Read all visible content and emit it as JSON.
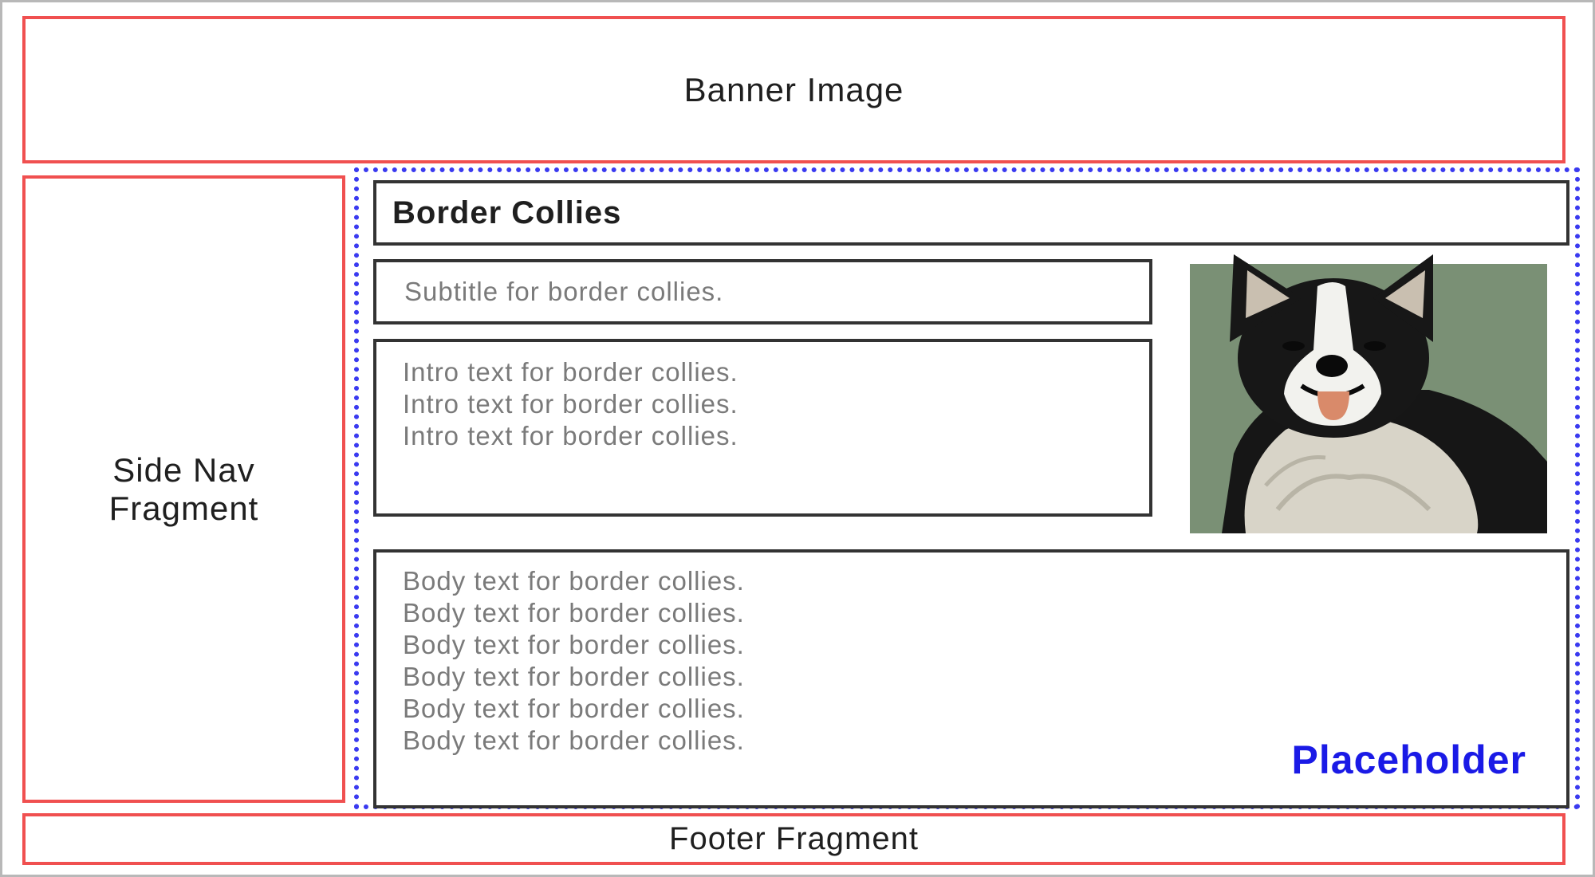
{
  "banner": {
    "label": "Banner Image"
  },
  "side_nav": {
    "line1": "Side Nav",
    "line2": "Fragment"
  },
  "footer": {
    "label": "Footer Fragment"
  },
  "placeholder": {
    "label": "Placeholder",
    "title": "Border Collies",
    "subtitle": "Subtitle for border collies.",
    "intro_lines": [
      "Intro text for border collies.",
      "Intro text for border collies.",
      "Intro text for border collies."
    ],
    "body_lines": [
      "Body text for border collies.",
      "Body text for border collies.",
      "Body text for border collies.",
      "Body text for border collies.",
      "Body text for border collies.",
      "Body text for border collies."
    ],
    "image": {
      "icon": "border-collie-dog-image"
    }
  },
  "colors": {
    "fragment_border": "#f05050",
    "placeholder_border": "#3a3af0",
    "placeholder_label": "#1a1ae6",
    "box_border": "#333333",
    "image_background": "#7a9075"
  }
}
